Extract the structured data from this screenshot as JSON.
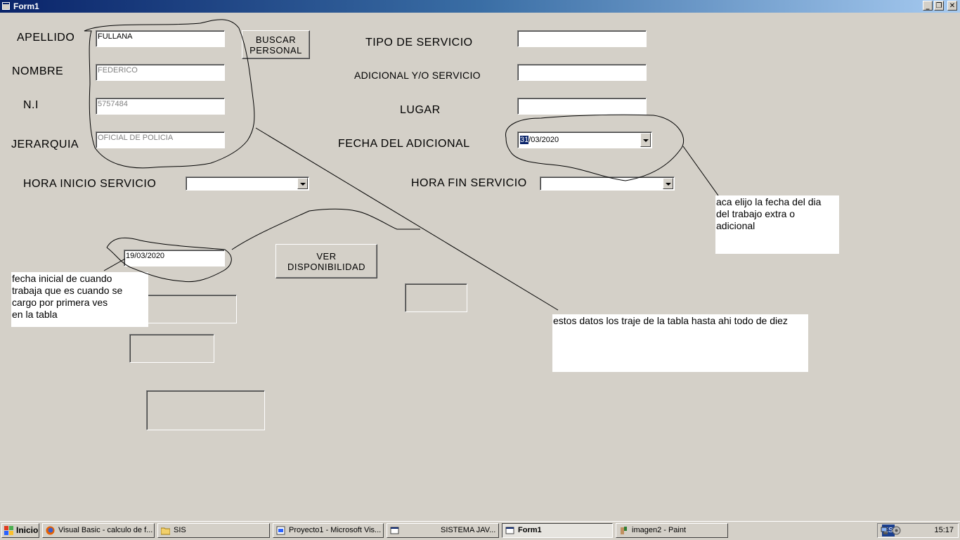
{
  "window": {
    "title": "Form1",
    "min": "_",
    "max": "❐",
    "close": "✕"
  },
  "labels": {
    "apellido": "APELLIDO",
    "nombre": "NOMBRE",
    "ni": "N.I",
    "jerarquia": "JERARQUIA",
    "hora_inicio": "HORA INICIO SERVICIO",
    "tipo_servicio": "TIPO DE SERVICIO",
    "adicional": "ADICIONAL Y/O SERVICIO",
    "lugar": "LUGAR",
    "fecha_adicional": "FECHA DEL ADICIONAL",
    "hora_fin": "HORA FIN SERVICIO"
  },
  "fields": {
    "apellido": "FULLANA",
    "nombre": "FEDERICO",
    "ni": "5757484",
    "jerarquia": "OFICIAL DE POLICIA",
    "tipo_servicio": "",
    "adicional": "",
    "lugar": "",
    "fecha_inicial": "19/03/2020",
    "fecha_adicional_day": "31",
    "fecha_adicional_rest": "/03/2020"
  },
  "buttons": {
    "buscar_line1": "BUSCAR",
    "buscar_line2": "PERSONAL",
    "ver_line1": "VER",
    "ver_line2": "DISPONIBILIDAD"
  },
  "notes": {
    "fecha_inicial": [
      "fecha inicial de cuando",
      "trabaja que es cuando se",
      "cargo por primera ves",
      "en la tabla"
    ],
    "fecha_adicional": [
      "aca elijo la fecha del dia",
      "del trabajo extra o",
      "adicional"
    ],
    "datos": "estos datos los traje de la tabla hasta ahi todo de diez"
  },
  "taskbar": {
    "start": "Inicio",
    "items": [
      "Visual Basic - calculo de f...",
      "SIS",
      "Proyecto1 - Microsoft Vis...",
      "SISTEMA JAV...",
      "Form1",
      "imagen2 - Paint"
    ],
    "lang": "ES",
    "clock": "15:17"
  },
  "colors": {
    "titlebar": "#0a246a",
    "face": "#d4d0c8",
    "selection": "#0a246a"
  }
}
